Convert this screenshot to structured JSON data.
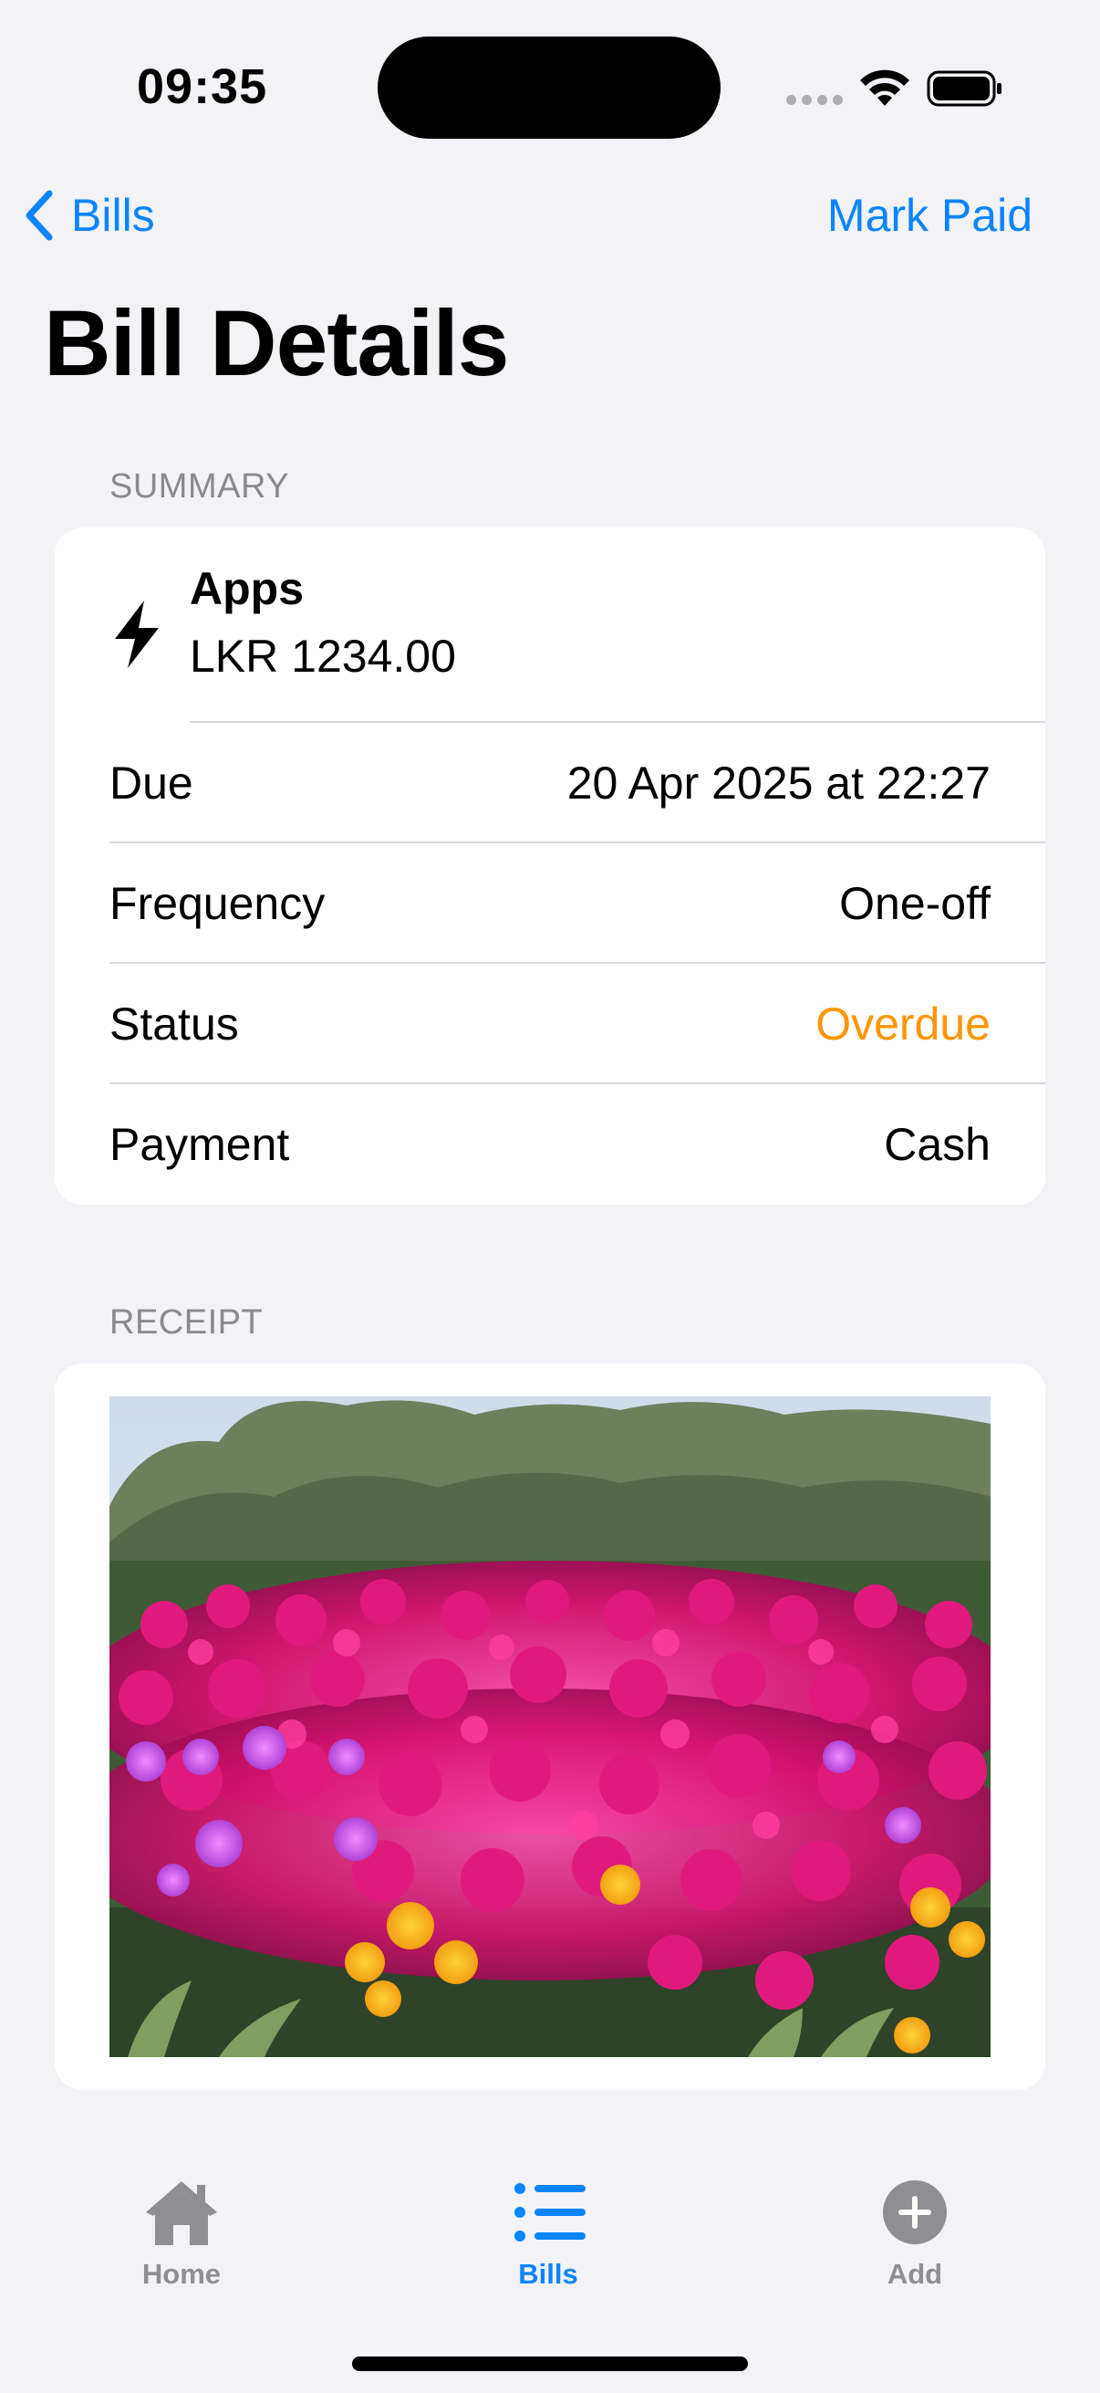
{
  "status_bar": {
    "time": "09:35"
  },
  "nav": {
    "back_label": "Bills",
    "action_label": "Mark Paid"
  },
  "page_title": "Bill Details",
  "summary": {
    "header": "SUMMARY",
    "icon": "bolt-icon",
    "name": "Apps",
    "amount": "LKR 1234.00",
    "rows": [
      {
        "label": "Due",
        "value": "20 Apr 2025 at 22:27"
      },
      {
        "label": "Frequency",
        "value": "One-off"
      },
      {
        "label": "Status",
        "value": "Overdue"
      },
      {
        "label": "Payment",
        "value": "Cash"
      }
    ]
  },
  "receipt": {
    "header": "RECEIPT",
    "image": "flowers-photo"
  },
  "tabs": [
    {
      "label": "Home",
      "icon": "house-icon",
      "active": false
    },
    {
      "label": "Bills",
      "icon": "list-icon",
      "active": true
    },
    {
      "label": "Add",
      "icon": "plus-circle-icon",
      "active": false
    }
  ],
  "colors": {
    "accent": "#0a84ff",
    "overdue": "#ff9500",
    "inactive_tab": "#8e8e93",
    "background": "#f2f2f7"
  }
}
